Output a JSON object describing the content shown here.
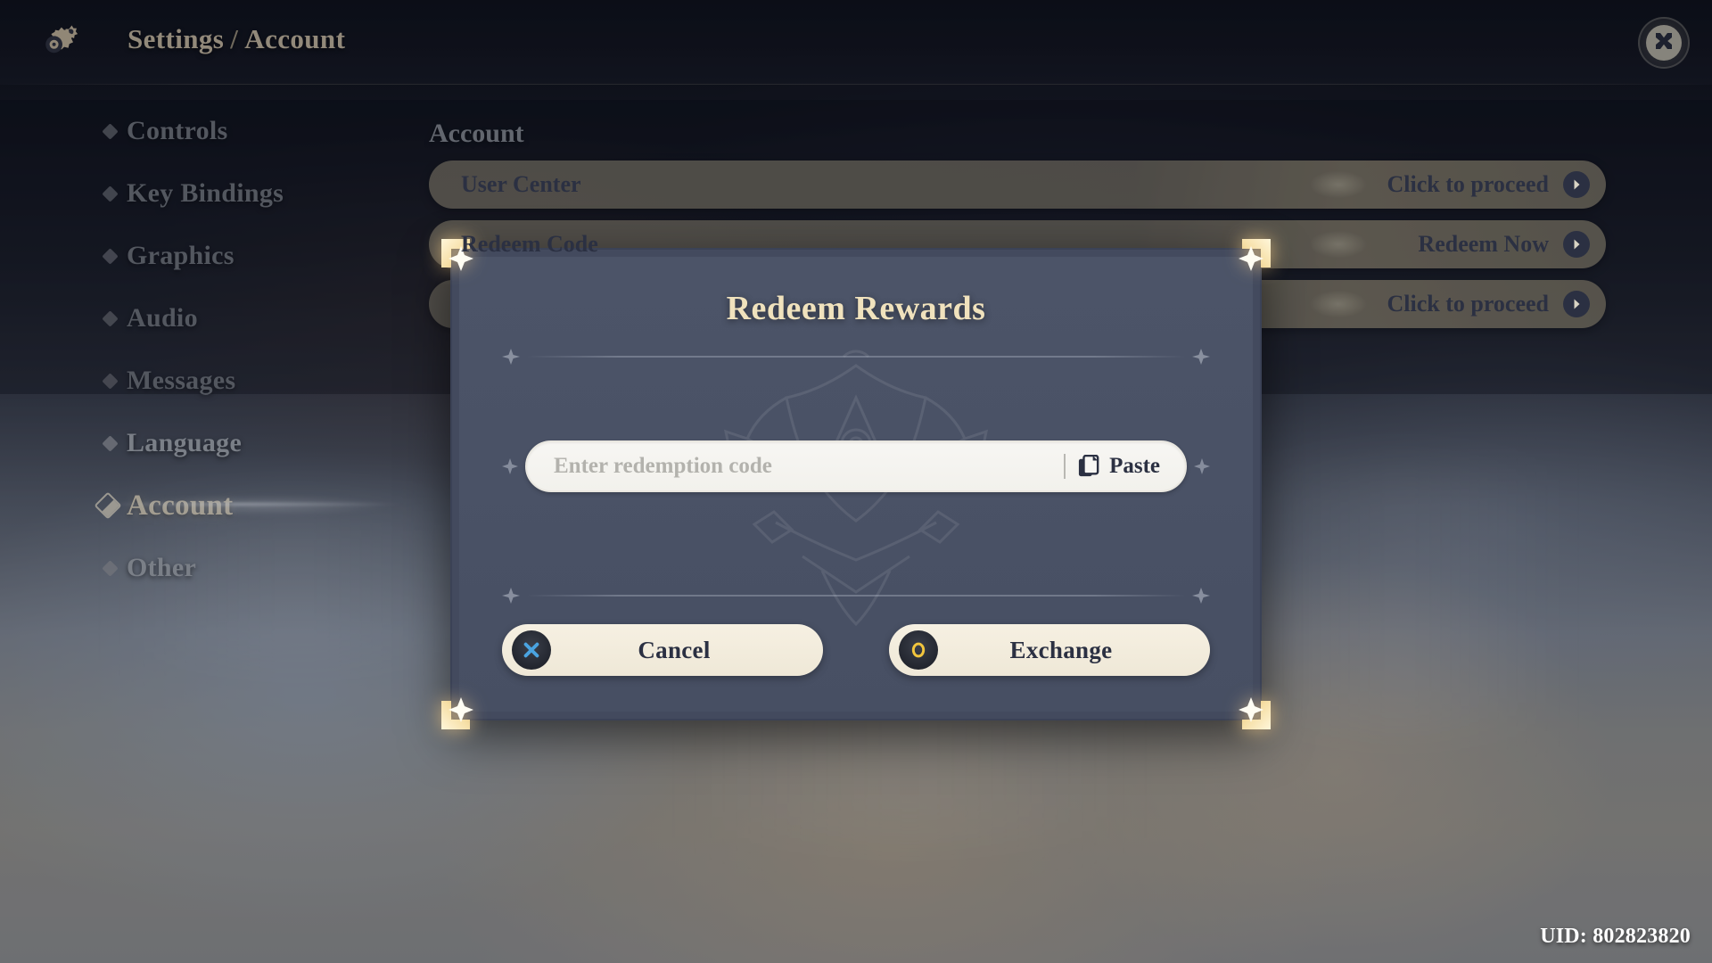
{
  "header": {
    "breadcrumb_root": "Settings",
    "breadcrumb_sep": "/",
    "breadcrumb_current": "Account",
    "gear_icon": "gear-icon",
    "close_icon": "close-x-icon"
  },
  "sidebar": {
    "items": [
      {
        "label": "Controls",
        "active": false
      },
      {
        "label": "Key Bindings",
        "active": false
      },
      {
        "label": "Graphics",
        "active": false
      },
      {
        "label": "Audio",
        "active": false
      },
      {
        "label": "Messages",
        "active": false
      },
      {
        "label": "Language",
        "active": false
      },
      {
        "label": "Account",
        "active": true
      },
      {
        "label": "Other",
        "active": false
      }
    ]
  },
  "main": {
    "section_title": "Account",
    "rows": [
      {
        "label": "User Center",
        "action": "Click to proceed",
        "icon": "chevron-right-icon"
      },
      {
        "label": "Redeem Code",
        "action": "Redeem Now",
        "icon": "chevron-right-icon"
      },
      {
        "label": "",
        "action": "Click to proceed",
        "icon": "chevron-right-icon"
      }
    ]
  },
  "modal": {
    "title": "Redeem Rewards",
    "input": {
      "value": "",
      "placeholder": "Enter redemption code",
      "paste_label": "Paste",
      "paste_icon": "clipboard-icon"
    },
    "buttons": [
      {
        "label": "Cancel",
        "glyph": "cross-button-icon",
        "glyph_char": "✕",
        "glyph_color": "#4aa3e0"
      },
      {
        "label": "Exchange",
        "glyph": "circle-button-icon",
        "glyph_char": "○",
        "glyph_color": "#f2c53d"
      }
    ]
  },
  "footer": {
    "uid": "UID: 802823820"
  },
  "colors": {
    "gold_title": "#f0e2bd",
    "panel": "#4a5266",
    "row_tan": "#b0a78f",
    "cream_button": "#f3ecdc",
    "dark_text": "#2b3042",
    "cancel_blue": "#4aa3e0",
    "exchange_gold": "#f2c53d"
  }
}
